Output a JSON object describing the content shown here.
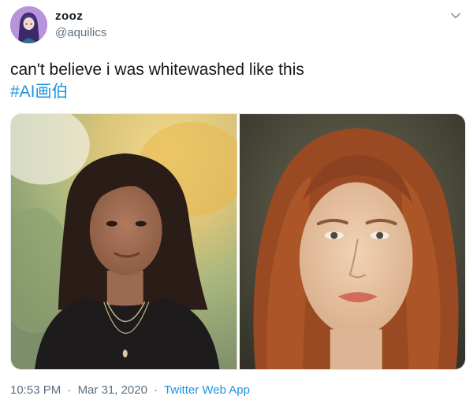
{
  "user": {
    "display_name": "zooz",
    "handle": "@aquilics",
    "avatar_icon": "anime-girl-avatar"
  },
  "tweet": {
    "text": "can't believe i was whitewashed like this",
    "hashtag": "#AI画伯"
  },
  "media": {
    "photos": [
      {
        "subject": "original-photo"
      },
      {
        "subject": "ai-painted-portrait"
      }
    ]
  },
  "meta": {
    "time": "10:53 PM",
    "date": "Mar 31, 2020",
    "separator": "·",
    "source": "Twitter Web App"
  },
  "colors": {
    "link": "#1b95e0",
    "secondary_text": "#5b7083",
    "primary_text": "#14171a"
  }
}
